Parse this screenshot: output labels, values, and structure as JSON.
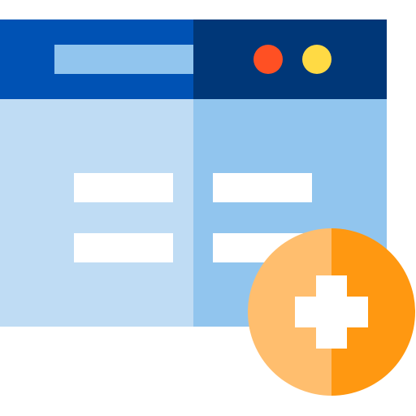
{
  "icon": {
    "name": "add-webpage-icon",
    "colors": {
      "titlebar_left": "#0052B4",
      "titlebar_right": "#003778",
      "address_bar": "#91C5EE",
      "panel_left": "#BFDCF4",
      "panel_right": "#91C5EE",
      "text_line": "#FFFFFF",
      "window_button_red": "#FF5023",
      "window_button_yellow": "#FFDA44",
      "badge_left": "#FFBE6E",
      "badge_right": "#FF9811",
      "plus": "#FFFFFF"
    }
  }
}
